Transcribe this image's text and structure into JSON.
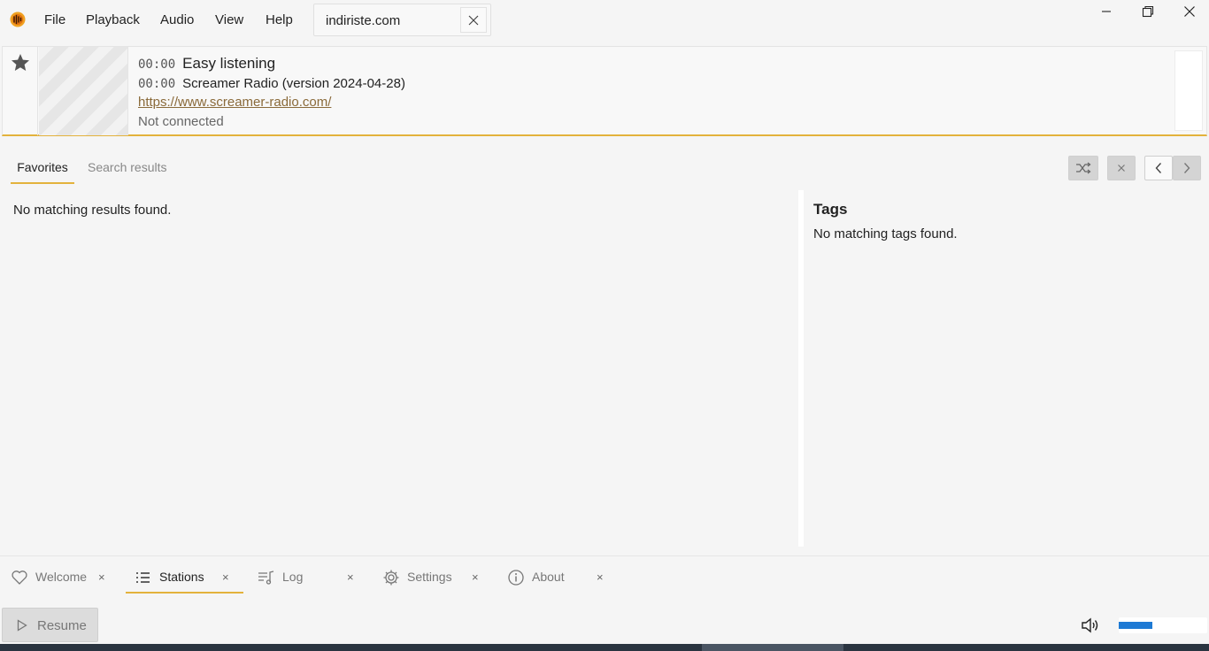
{
  "menu": {
    "items": [
      "File",
      "Playback",
      "Audio",
      "View",
      "Help"
    ]
  },
  "search": {
    "value": "indiriste.com"
  },
  "now_playing": {
    "lines": [
      {
        "time": "00:00",
        "text": "Easy listening"
      },
      {
        "time": "00:00",
        "text": "Screamer Radio (version 2024-04-28)"
      }
    ],
    "link": "https://www.screamer-radio.com/",
    "status": "Not connected"
  },
  "tabs": {
    "favorites": "Favorites",
    "search_results": "Search results"
  },
  "results": {
    "empty_message": "No matching results found."
  },
  "tags": {
    "heading": "Tags",
    "empty_message": "No matching tags found."
  },
  "bottom_tabs": [
    {
      "label": "Welcome",
      "icon": "heart-icon",
      "active": false
    },
    {
      "label": "Stations",
      "icon": "list-icon",
      "active": true
    },
    {
      "label": "Log",
      "icon": "music-list-icon",
      "active": false
    },
    {
      "label": "Settings",
      "icon": "gear-icon",
      "active": false
    },
    {
      "label": "About",
      "icon": "info-icon",
      "active": false
    }
  ],
  "footer": {
    "resume_label": "Resume",
    "volume_percent": 38
  },
  "colors": {
    "accent": "#e3b23c",
    "volume": "#1e7ad4",
    "link": "#8a6a3a"
  }
}
